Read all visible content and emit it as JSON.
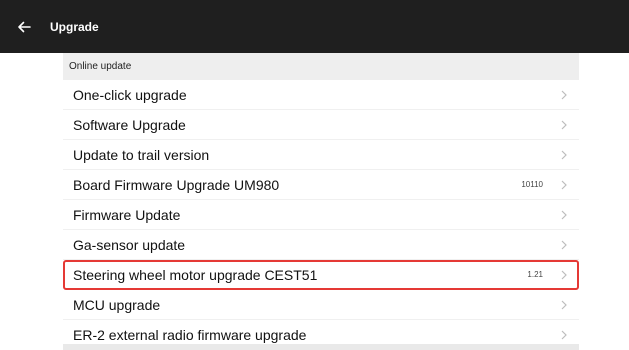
{
  "header": {
    "title": "Upgrade",
    "background": "#1f1f1f"
  },
  "section": {
    "title": "Online update"
  },
  "items": [
    {
      "label": "One-click upgrade",
      "value": ""
    },
    {
      "label": "Software Upgrade",
      "value": ""
    },
    {
      "label": "Update to trail version",
      "value": ""
    },
    {
      "label": "Board Firmware Upgrade  UM980",
      "value": "10110"
    },
    {
      "label": "Firmware Update",
      "value": ""
    },
    {
      "label": "Ga-sensor update",
      "value": ""
    },
    {
      "label": "Steering wheel motor upgrade CEST51",
      "value": "1.21",
      "highlighted": true
    },
    {
      "label": "MCU upgrade",
      "value": ""
    },
    {
      "label": "ER-2 external radio firmware upgrade",
      "value": ""
    }
  ],
  "colors": {
    "highlight_border": "#e53935",
    "section_bg": "#eeeeee"
  }
}
